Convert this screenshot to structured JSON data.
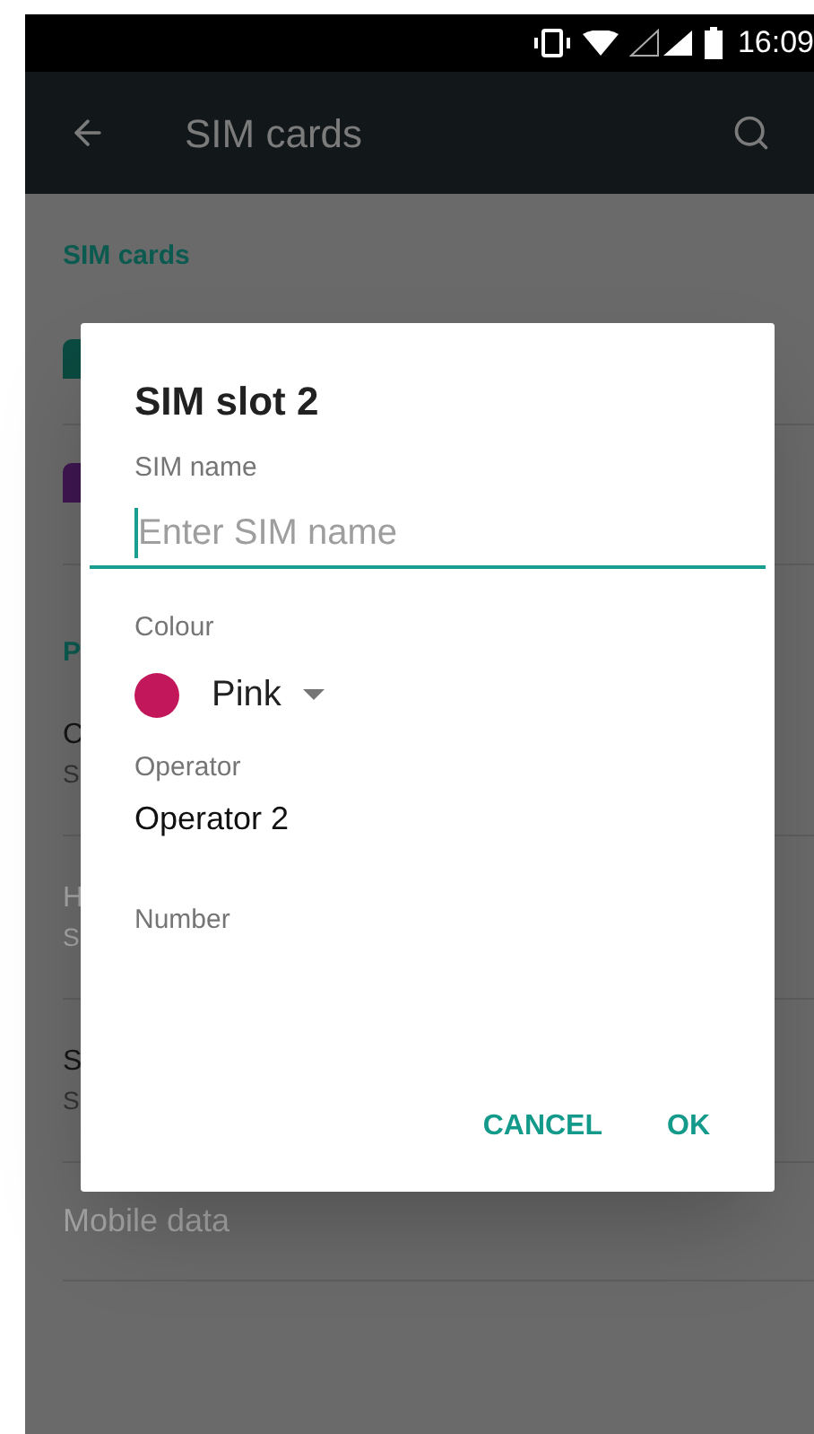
{
  "status_bar": {
    "time": "16:09"
  },
  "toolbar": {
    "title": "SIM cards"
  },
  "background": {
    "section_header": "SIM cards",
    "sim_icons": [
      {
        "color": "#0b4a40"
      },
      {
        "color": "#3e1650"
      }
    ],
    "preferences_header": "P",
    "rows": [
      {
        "title": "C",
        "subtitle": "S",
        "disabled": false
      },
      {
        "title": "H",
        "subtitle": "S",
        "disabled": true
      },
      {
        "title": "S",
        "subtitle": "S",
        "disabled": false
      }
    ],
    "mobile_data": {
      "title": "Mobile data",
      "disabled": true
    }
  },
  "dialog": {
    "title": "SIM slot 2",
    "name_field": {
      "label": "SIM name",
      "placeholder": "Enter SIM name",
      "focused": true
    },
    "colour": {
      "label": "Colour",
      "value": "Pink",
      "color": "#c2185b"
    },
    "operator": {
      "label": "Operator",
      "value": "Operator 2"
    },
    "number": {
      "label": "Number"
    },
    "buttons": [
      "CANCEL",
      "OK"
    ]
  }
}
